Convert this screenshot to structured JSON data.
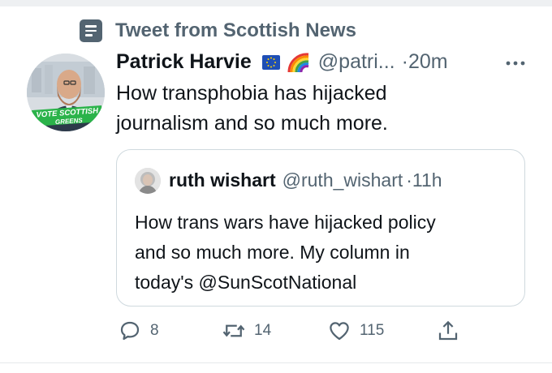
{
  "context": {
    "label": "Tweet from Scottish News",
    "icon": "list-icon"
  },
  "tweet": {
    "author_name": "Patrick Harvie",
    "author_emoji": [
      "eu-flag",
      "rainbow"
    ],
    "handle": "@patri...",
    "separator": "·",
    "time": "20m",
    "avatar_badge": "VOTE SCOTTISH GREENS",
    "text_lines": [
      "How transphobia has hijacked",
      "journalism and so much more."
    ]
  },
  "quote": {
    "author_name": "ruth wishart",
    "handle": "@ruth_wishart",
    "separator": "·",
    "time": "11h",
    "text_lines": [
      "How trans wars have hijacked policy",
      "and so much more. My column in",
      "today's @SunScotNational"
    ]
  },
  "actions": {
    "replies": "8",
    "retweets": "14",
    "likes": "115"
  },
  "colors": {
    "muted": "#536471",
    "text": "#0f1419",
    "border": "#cfd9de",
    "green_badge": "#2bb34a"
  }
}
